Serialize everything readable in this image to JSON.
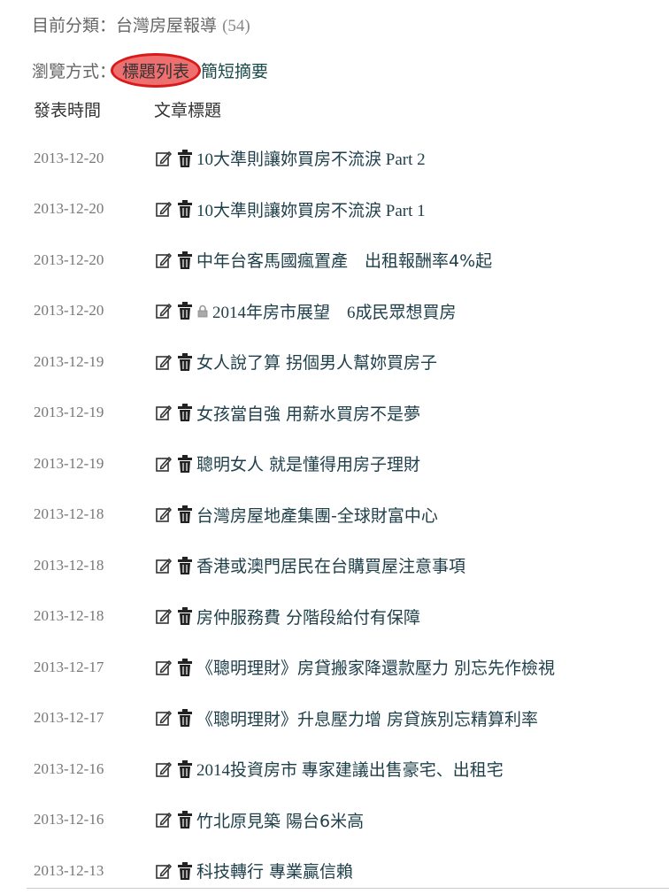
{
  "category": {
    "label": "目前分類：",
    "name": "台灣房屋報導",
    "count": "(54)"
  },
  "view_mode": {
    "label": "瀏覽方式：",
    "active": "標題列表",
    "alternate": "簡短摘要",
    "highlight_color": "#ee6f6f"
  },
  "columns": {
    "date": "發表時間",
    "title": "文章標題"
  },
  "icons": {
    "edit": "edit-icon",
    "delete": "trash-icon",
    "lock": "lock-icon"
  },
  "articles": [
    {
      "date": "2013-12-20",
      "title": "10大準則讓妳買房不流淚 Part 2",
      "locked": false
    },
    {
      "date": "2013-12-20",
      "title": "10大準則讓妳買房不流淚 Part 1",
      "locked": false
    },
    {
      "date": "2013-12-20",
      "title": "中年台客馬國瘋置產　出租報酬率4%起",
      "locked": false
    },
    {
      "date": "2013-12-20",
      "title": "2014年房市展望　6成民眾想買房",
      "locked": true
    },
    {
      "date": "2013-12-19",
      "title": "女人說了算 拐個男人幫妳買房子",
      "locked": false
    },
    {
      "date": "2013-12-19",
      "title": "女孩當自強 用薪水買房不是夢",
      "locked": false
    },
    {
      "date": "2013-12-19",
      "title": "聰明女人 就是懂得用房子理財",
      "locked": false
    },
    {
      "date": "2013-12-18",
      "title": "台灣房屋地產集團-全球財富中心",
      "locked": false
    },
    {
      "date": "2013-12-18",
      "title": "香港或澳門居民在台購買屋注意事項",
      "locked": false
    },
    {
      "date": "2013-12-18",
      "title": "房仲服務費 分階段給付有保障",
      "locked": false
    },
    {
      "date": "2013-12-17",
      "title": "《聰明理財》房貸搬家降還款壓力 別忘先作檢視",
      "locked": false
    },
    {
      "date": "2013-12-17",
      "title": "《聰明理財》升息壓力增 房貸族別忘精算利率",
      "locked": false
    },
    {
      "date": "2013-12-16",
      "title": "2014投資房市 專家建議出售豪宅、出租宅",
      "locked": false
    },
    {
      "date": "2013-12-16",
      "title": "竹北原見築 陽台6米高",
      "locked": false
    },
    {
      "date": "2013-12-13",
      "title": "科技轉行 專業贏信賴",
      "locked": false
    }
  ]
}
